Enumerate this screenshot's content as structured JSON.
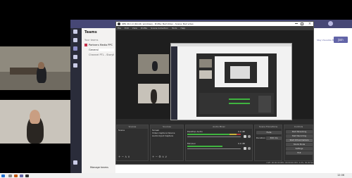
{
  "teams": {
    "panel_title": "Teams",
    "section_label": "Your teams",
    "team_name": "Partners Media PPC",
    "channels": [
      "General",
      "Channel PTL - Storyline..."
    ],
    "bottom_item": "Manage teams",
    "join_button": "Join",
    "right_badge": "Stay Visualize Me"
  },
  "obs": {
    "window_title": "OBS 26.1.0 (64-bit, windows) - Profile: Bell Video - Scene: Bell video",
    "menu": [
      "File",
      "Edit",
      "View",
      "Profile",
      "Scene Collection",
      "Tools",
      "Help"
    ],
    "docks": {
      "scenes": "Scenes",
      "sources": "Sources",
      "mixer": "Audio Mixer",
      "transitions": "Scene Transitions",
      "controls": "Controls"
    },
    "scene_items": [
      "Scene"
    ],
    "source_items": [
      "Screen",
      "Video Capture Device",
      "Audio Input Capture"
    ],
    "mixer_tracks": [
      {
        "name": "Desktop Audio",
        "db": "0.0 dB"
      },
      {
        "name": "Mic/Aux",
        "db": "0.0 dB"
      }
    ],
    "transition": {
      "label": "Fade",
      "duration_label": "Duration",
      "duration": "300 ms"
    },
    "controls": [
      "Start Streaming",
      "Start Recording",
      "Start Virtual Camera",
      "Studio Mode",
      "Settings",
      "Exit"
    ],
    "status": "LIVE: 00:00:00  REC: 00:00:00  CPU: 2.0%, 30.00 fps"
  },
  "colors": {
    "teams_rail": "#2a2c3a",
    "teams_accent": "#6264a7",
    "obs_bg": "#2b2b2b",
    "meter_green": "#3fb43f"
  },
  "taskbar": {
    "clock": "12:06"
  }
}
